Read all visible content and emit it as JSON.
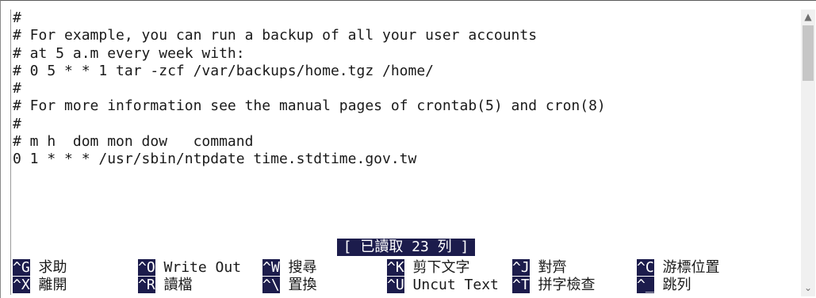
{
  "editor": {
    "lines": [
      "#",
      "# For example, you can run a backup of all your user accounts",
      "# at 5 a.m every week with:",
      "# 0 5 * * 1 tar -zcf /var/backups/home.tgz /home/",
      "#",
      "# For more information see the manual pages of crontab(5) and cron(8)",
      "#",
      "# m h  dom mon dow   command",
      "0 1 * * * /usr/sbin/ntpdate time.stdtime.gov.tw"
    ],
    "status": "[ 已讀取 23 列 ]"
  },
  "shortcuts": {
    "row1": [
      {
        "key": "^G",
        "label": " 求助"
      },
      {
        "key": "^O",
        "label": " Write Out"
      },
      {
        "key": "^W",
        "label": " 搜尋"
      },
      {
        "key": "^K",
        "label": " 剪下文字"
      },
      {
        "key": "^J",
        "label": " 對齊"
      },
      {
        "key": "^C",
        "label": " 游標位置"
      }
    ],
    "row2": [
      {
        "key": "^X",
        "label": " 離開"
      },
      {
        "key": "^R",
        "label": " 讀檔"
      },
      {
        "key": "^\\",
        "label": " 置換"
      },
      {
        "key": "^U",
        "label": " Uncut Text"
      },
      {
        "key": "^T",
        "label": " 拼字檢查"
      },
      {
        "key": "^_",
        "label": " 跳列"
      }
    ]
  },
  "scrollbar": {
    "up_icon": "chevron-up-icon",
    "down_icon": "chevron-down-icon"
  }
}
